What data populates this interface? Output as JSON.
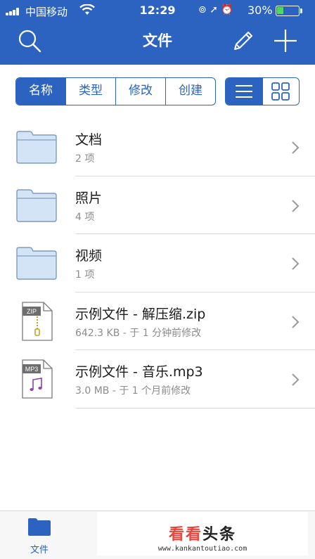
{
  "status_bar": {
    "carrier": "中国移动",
    "time": "12:29",
    "battery_percent": "30%",
    "icons": [
      "signal-icon",
      "wifi-icon",
      "lock-rotation-icon",
      "location-icon",
      "alarm-icon",
      "battery-icon"
    ]
  },
  "nav": {
    "title": "文件",
    "left_icon": "search-icon",
    "right_icons": [
      "edit-icon",
      "add-icon"
    ]
  },
  "sort_tabs": [
    {
      "label": "名称",
      "active": true
    },
    {
      "label": "类型",
      "active": false
    },
    {
      "label": "修改",
      "active": false
    },
    {
      "label": "创建",
      "active": false
    }
  ],
  "view_toggle": {
    "options": [
      "list-view-icon",
      "grid-view-icon"
    ],
    "selected": "list-view-icon"
  },
  "files": [
    {
      "name": "文档",
      "meta": "2 项",
      "type": "folder"
    },
    {
      "name": "照片",
      "meta": "4 项",
      "type": "folder"
    },
    {
      "name": "视频",
      "meta": "1 项",
      "type": "folder"
    },
    {
      "name": "示例文件 - 解压缩.zip",
      "meta": "642.3 KB - 于 1 分钟前修改",
      "type": "zip",
      "badge": "ZIP"
    },
    {
      "name": "示例文件 - 音乐.mp3",
      "meta": "3.0 MB - 于 1 个月前修改",
      "type": "mp3",
      "badge": "MP3"
    }
  ],
  "tab_bar": {
    "items": [
      {
        "label": "文件",
        "icon": "folder-icon",
        "active": true
      }
    ]
  },
  "watermark": {
    "title_red": "看看",
    "title_dark": "头条",
    "url": "www.kankantoutiao.com"
  },
  "colors": {
    "accent": "#2c63c1",
    "folder_fill": "#d3e4f6",
    "folder_stroke": "#7f9cbe",
    "battery_green": "#4cd964",
    "watermark_red": "#e8463c"
  }
}
